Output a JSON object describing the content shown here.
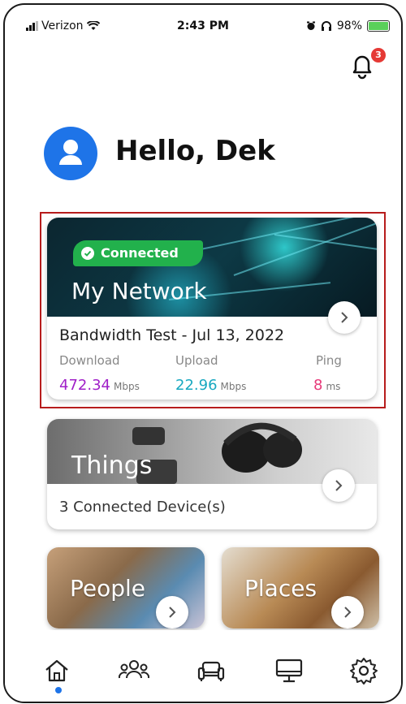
{
  "status_bar": {
    "carrier": "Verizon",
    "time": "2:43 PM",
    "battery": "98%"
  },
  "notifications": {
    "count": "3"
  },
  "header": {
    "greeting": "Hello, Dek"
  },
  "network_card": {
    "status": "Connected",
    "title": "My Network",
    "test_title": "Bandwidth Test - Jul 13, 2022",
    "download_label": "Download",
    "upload_label": "Upload",
    "ping_label": "Ping",
    "download_value": "472.34",
    "download_unit": "Mbps",
    "upload_value": "22.96",
    "upload_unit": "Mbps",
    "ping_value": "8",
    "ping_unit": "ms",
    "colors": {
      "download": "#a020c8",
      "upload": "#18a8c0",
      "ping": "#e83a7a",
      "connected": "#22b14c"
    }
  },
  "things_card": {
    "title": "Things",
    "subtitle": "3 Connected Device(s)"
  },
  "people_card": {
    "title": "People"
  },
  "places_card": {
    "title": "Places"
  },
  "tabbar": {
    "tabs": [
      {
        "icon": "home-icon",
        "active": true
      },
      {
        "icon": "people-icon"
      },
      {
        "icon": "couch-icon"
      },
      {
        "icon": "monitor-icon"
      },
      {
        "icon": "gear-icon"
      }
    ],
    "accent": "#1e74e8"
  }
}
